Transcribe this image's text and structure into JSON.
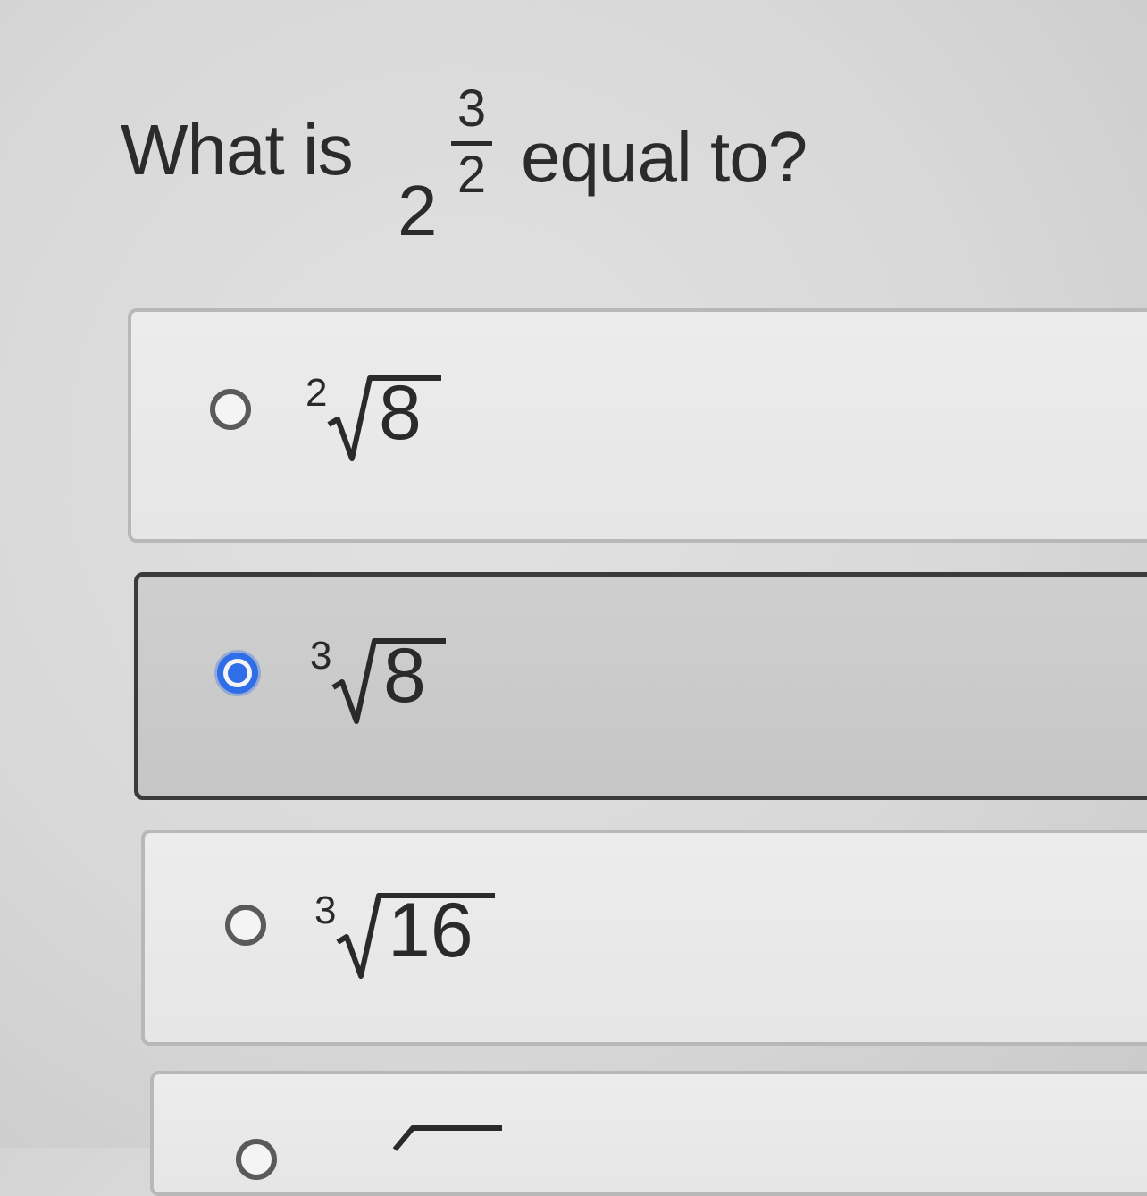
{
  "question": {
    "prefix": "What is",
    "base": "2",
    "exponent_numerator": "3",
    "exponent_denominator": "2",
    "suffix": "equal to?"
  },
  "options": [
    {
      "index": "2",
      "radicand": "8",
      "selected": false
    },
    {
      "index": "3",
      "radicand": "8",
      "selected": true
    },
    {
      "index": "3",
      "radicand": "16",
      "selected": false
    }
  ],
  "colors": {
    "radio_selected": "#2f6ee8",
    "selected_card_border": "#3b3b3b",
    "unselected_card_border": "#b8b8b8",
    "text": "#2a2a2a"
  }
}
